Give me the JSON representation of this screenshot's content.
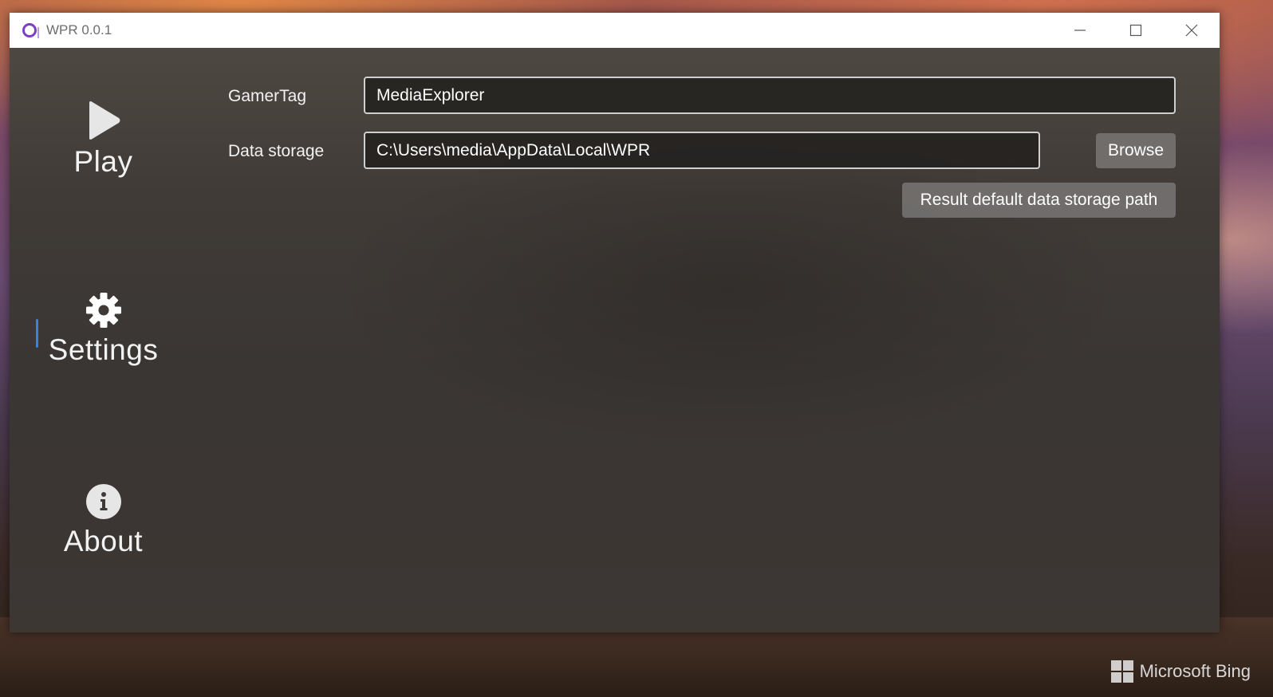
{
  "window": {
    "title": "WPR 0.0.1",
    "controls": [
      "minimize-icon",
      "maximize-icon",
      "close-icon"
    ]
  },
  "sidebar": {
    "items": [
      {
        "label": "Play",
        "icon": "play-icon",
        "selected": false
      },
      {
        "label": "Settings",
        "icon": "gear-icon",
        "selected": true
      },
      {
        "label": "About",
        "icon": "info-icon",
        "selected": false
      }
    ],
    "selected_indicator_color": "#2f86e6"
  },
  "settings": {
    "gamertag_label": "GamerTag",
    "gamertag_value": "MediaExplorer",
    "data_storage_label": "Data storage",
    "data_storage_value": "C:\\Users\\media\\AppData\\Local\\WPR",
    "browse_label": "Browse",
    "reset_label": "Result default data storage path"
  },
  "desktop": {
    "watermark": "Microsoft Bing"
  }
}
